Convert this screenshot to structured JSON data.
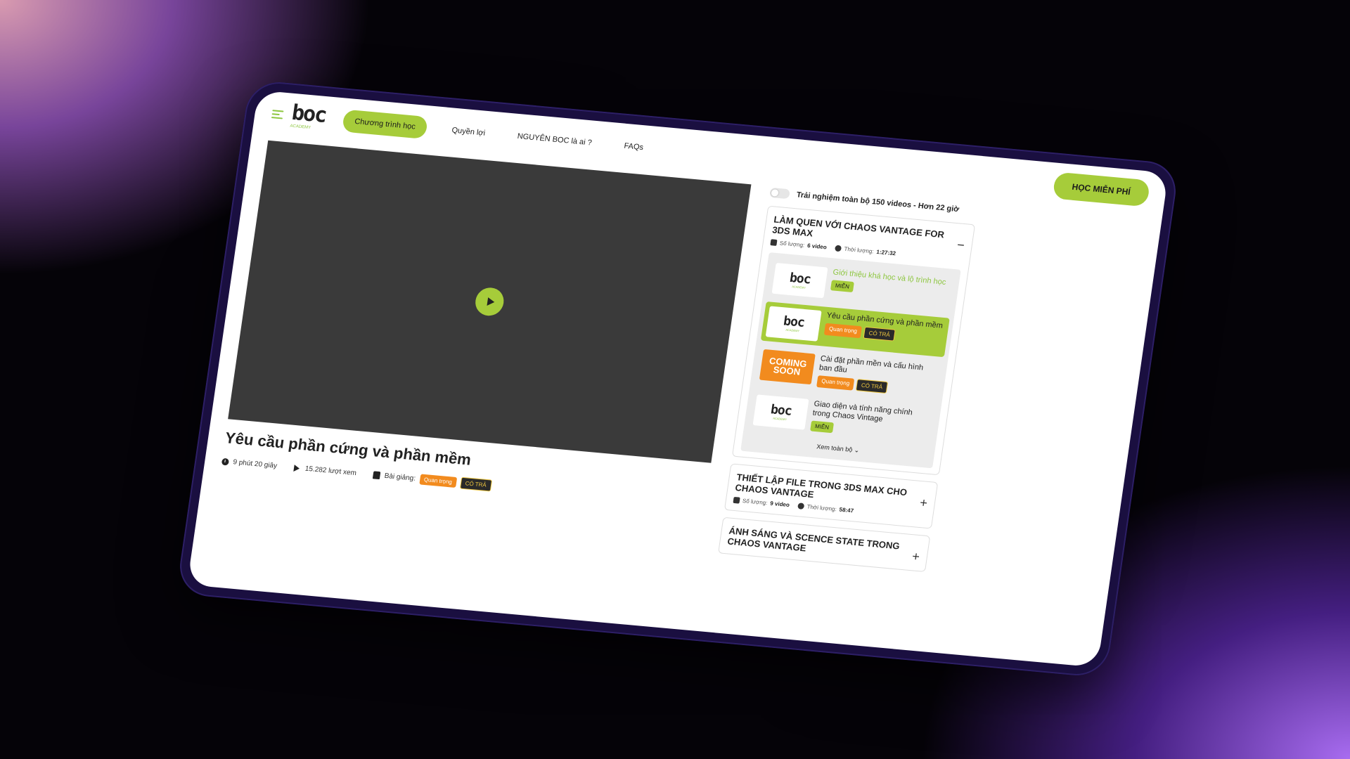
{
  "nav": {
    "logo": "boc",
    "logo_sub": "ACADEMY",
    "items": [
      "Chương trình học",
      "Quyền lợi",
      "NGUYÊN BOC là ai ?",
      "FAQs"
    ],
    "cta": "HỌC MIỄN PHÍ"
  },
  "video": {
    "title": "Yêu cầu phần cứng và phần mềm",
    "duration": "9 phút 20 giây",
    "views": "15.282 lượt xem",
    "lecture_label": "Bài giảng:",
    "tag1": "Quan trọng",
    "tag2": "CÓ TRẢ"
  },
  "panel": {
    "toggle_label": "Trải nghiệm toàn bộ 150 videos - Hơn 22 giờ",
    "sections": [
      {
        "title": "LÀM QUEN VỚI CHAOS VANTAGE FOR 3DS MAX",
        "count_label": "Số lượng:",
        "count": "6 video",
        "time_label": "Thời lượng:",
        "time": "1:27:32",
        "toggle": "−",
        "lessons": [
          {
            "title": "Giới thiệu khá học và lộ trình học",
            "tags": [
              "MIỄN"
            ]
          },
          {
            "title": "Yêu cầu phần cứng và phần mềm",
            "tags": [
              "Quan trọng",
              "CÓ TRẢ"
            ]
          },
          {
            "title": "Cài đặt phần mền và cấu hình ban đầu",
            "tags": [
              "Quan trọng",
              "CÓ TRẢ"
            ],
            "thumb": "COMING SOON"
          },
          {
            "title": "Giao diện và tính năng chính trong Chaos Vintage",
            "tags": [
              "MIỄN"
            ]
          }
        ],
        "see_all": "Xem toàn bộ"
      },
      {
        "title": "THIẾT LẬP FILE TRONG 3DS MAX CHO CHAOS VANTAGE",
        "count_label": "Số lượng:",
        "count": "9 video",
        "time_label": "Thời lượng:",
        "time": "58:47",
        "toggle": "+"
      },
      {
        "title": "ÁNH SÁNG VÀ SCENCE STATE TRONG CHAOS VANTAGE",
        "toggle": "+"
      }
    ]
  }
}
